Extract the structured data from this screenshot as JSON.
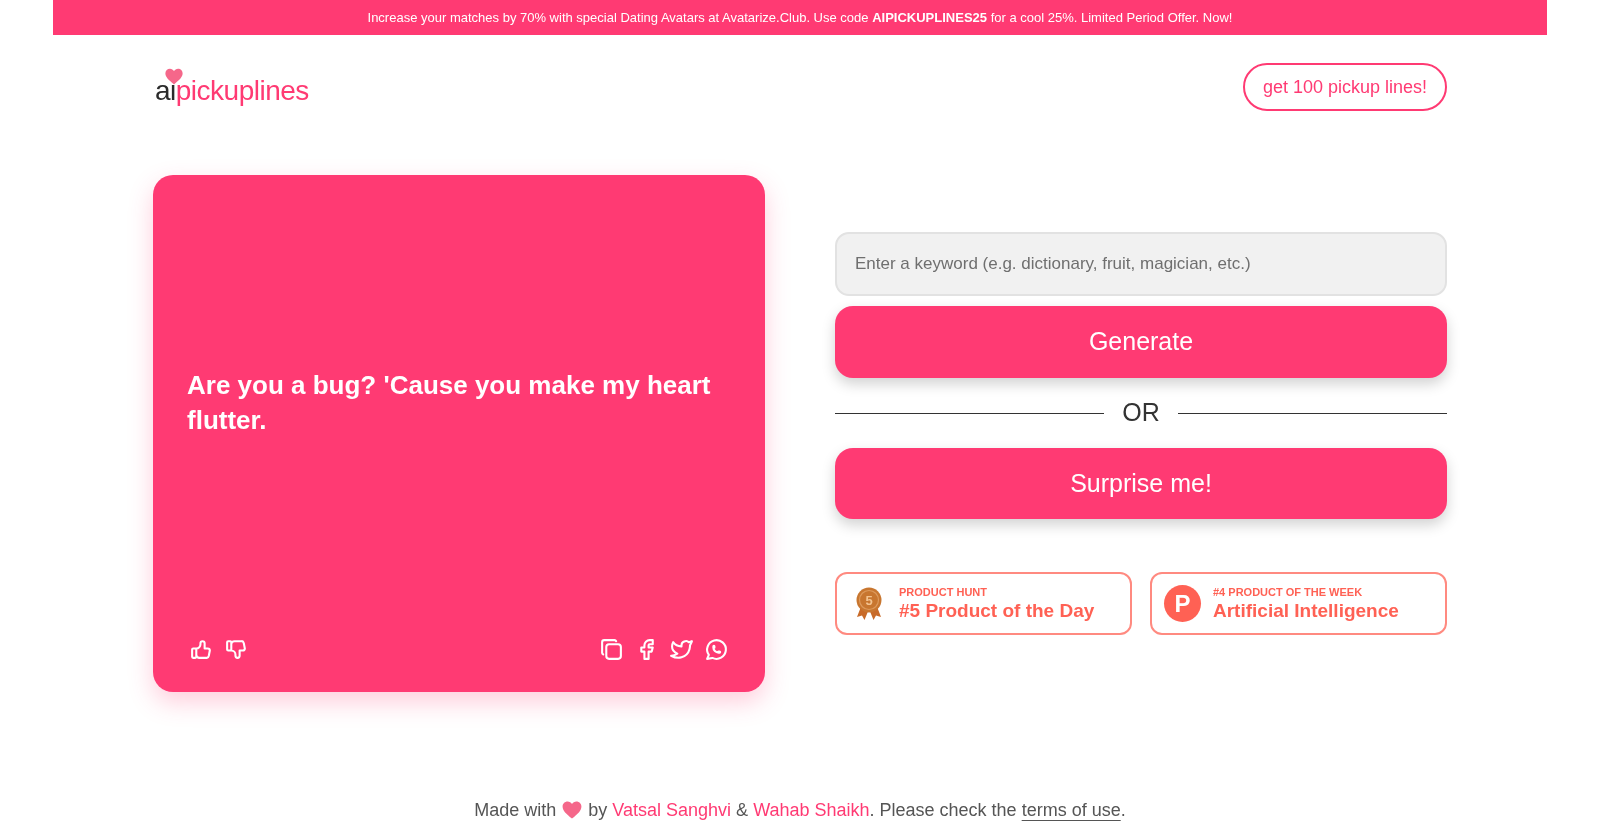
{
  "promo_banner": {
    "text": "Increase your matches by 70% with special Dating Avatars at Avatarize.Club. Use code **AIPICKUPLINES25** for a cool 25%. Limited Period Offer. Now!"
  },
  "header": {
    "logo": {
      "part_1": "ai",
      "part_2": "pickuplines"
    },
    "cta_button": "get 100 pickup lines!"
  },
  "pickup_line_card": {
    "text": "Are you a bug? 'Cause you make my heart flutter."
  },
  "generator": {
    "keyword_field": {
      "placeholder": "Enter a keyword (e.g. dictionary, fruit, magician, etc.)"
    },
    "generate_button": "Generate",
    "divider_text": "OR",
    "surprise_button": "Surprise me!"
  },
  "badges": [
    {
      "kind": "medal",
      "icon_text": "5",
      "label": "PRODUCT HUNT",
      "title": "#5 Product of the Day"
    },
    {
      "kind": "letter_logo",
      "icon_text": "P",
      "label": "#4 PRODUCT OF THE WEEK",
      "title": "Artificial Intelligence"
    }
  ],
  "footer": {
    "made_with": "Made with",
    "by": "by",
    "author_1": "Vatsal Sanghvi",
    "joiner": "&",
    "author_2": "Wahab Shaikh",
    "terms_prefix": ". Please check the",
    "terms_link": "terms of use",
    "end": "."
  }
}
